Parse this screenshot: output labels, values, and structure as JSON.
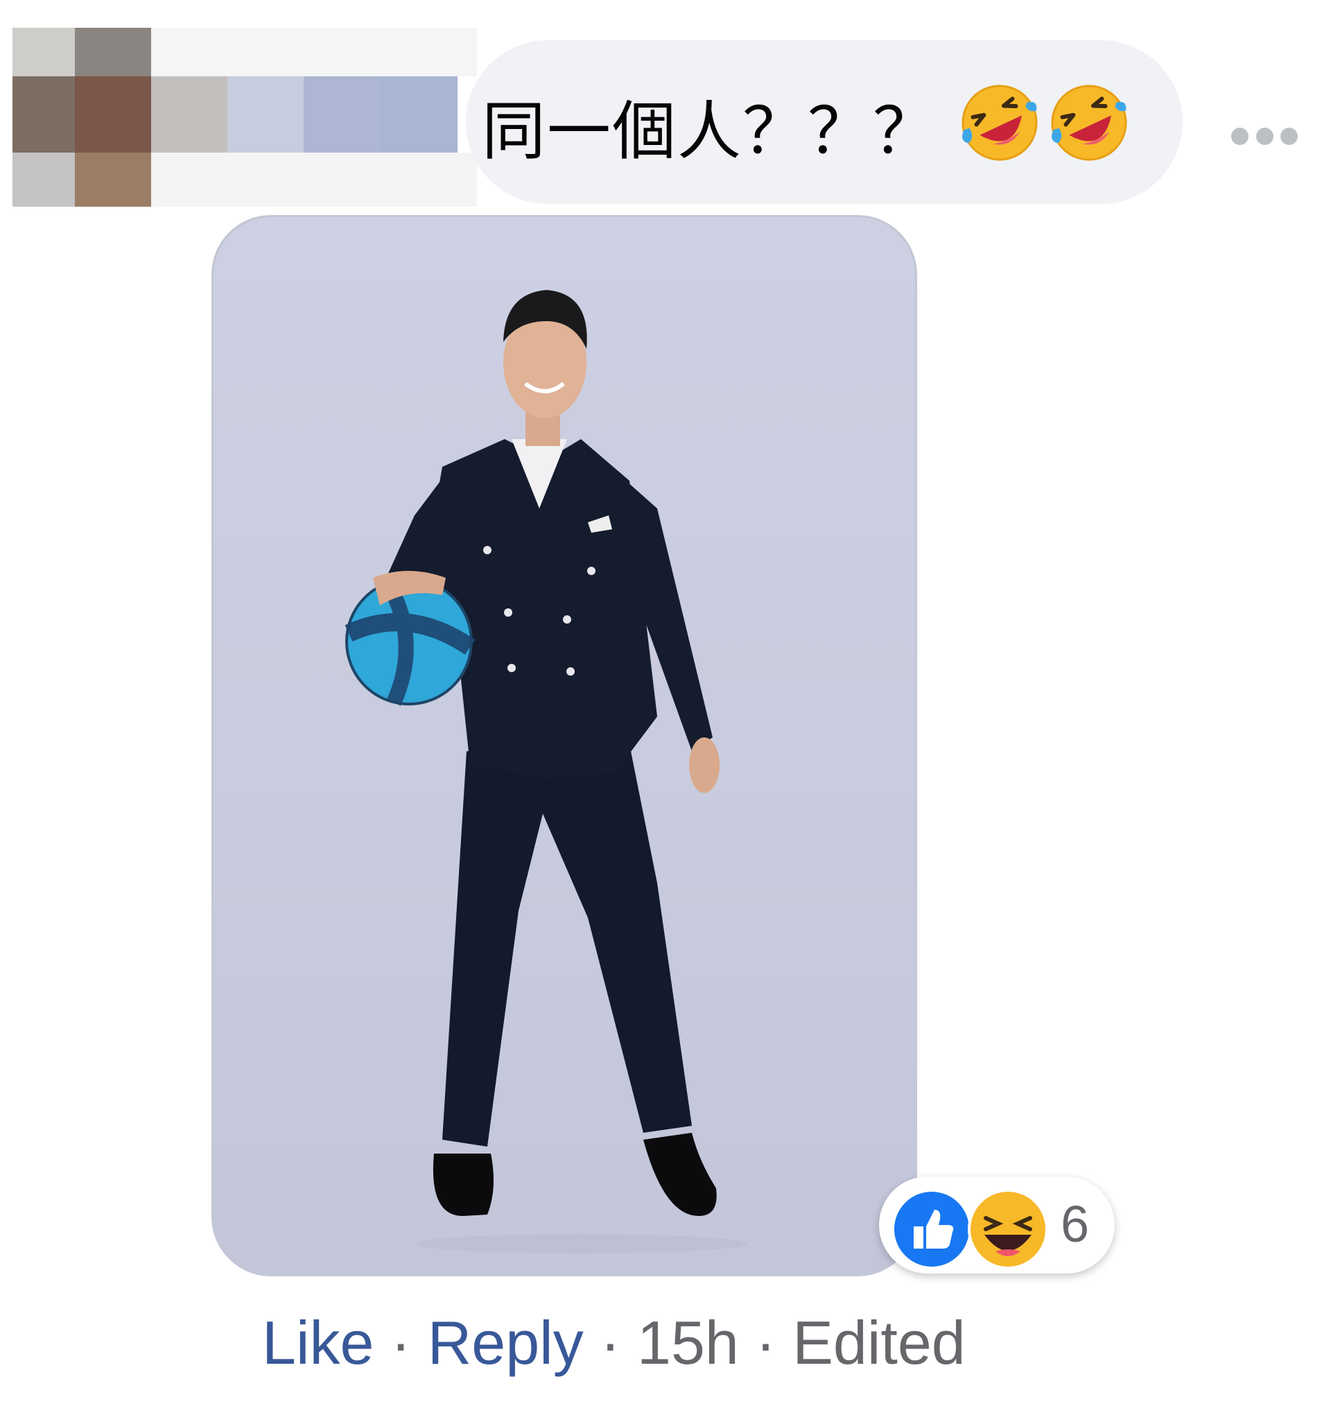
{
  "comment": {
    "text": "同一個人？？？",
    "emojis": [
      "rolling-on-the-floor-laughing",
      "rolling-on-the-floor-laughing"
    ]
  },
  "reactions": {
    "types": [
      "like",
      "haha"
    ],
    "count": "6"
  },
  "actions": {
    "like": "Like",
    "reply": "Reply",
    "time": "15h",
    "edited": "Edited",
    "separator": "·"
  },
  "colors": {
    "bubble": "#f0f2f5",
    "link": "#385898",
    "meta": "#65676b",
    "like_blue": "#1877f2",
    "haha_yellow": "#f7b928"
  }
}
